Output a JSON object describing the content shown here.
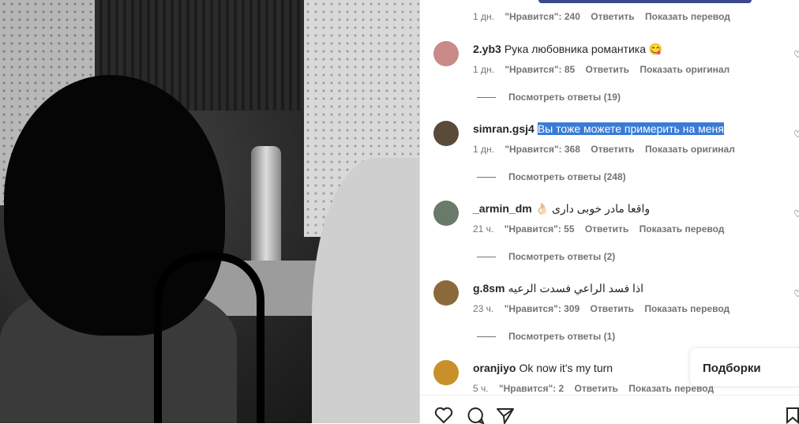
{
  "top_meta": {
    "time": "1 дн.",
    "likes": "\"Нравится\": 240",
    "reply": "Ответить",
    "translate": "Показать перевод"
  },
  "comments": [
    {
      "user": "2.yb3",
      "text": "Рука любовника романтика 😋",
      "time": "1 дн.",
      "likes": "\"Нравится\": 85",
      "reply": "Ответить",
      "action": "Показать оригинал",
      "replies": "Посмотреть ответы (19)",
      "avatar_color": "#c98a8a"
    },
    {
      "user": "simran.gsj4",
      "text": "Вы тоже можете примерить на меня",
      "time": "1 дн.",
      "likes": "\"Нравится\": 368",
      "reply": "Ответить",
      "action": "Показать оригинал",
      "replies": "Посмотреть ответы (248)",
      "avatar_color": "#5a4a3a"
    },
    {
      "user": "_armin_dm",
      "text": "👌🏻 واقعا مادر خوبی داری",
      "time": "21 ч.",
      "likes": "\"Нравится\": 55",
      "reply": "Ответить",
      "action": "Показать перевод",
      "replies": "Посмотреть ответы (2)",
      "avatar_color": "#6a7a6a"
    },
    {
      "user": "g.8sm",
      "text": "اذا فسد الراعي فسدت الرعيه",
      "time": "23 ч.",
      "likes": "\"Нравится\": 309",
      "reply": "Ответить",
      "action": "Показать перевод",
      "replies": "Посмотреть ответы (1)",
      "avatar_color": "#8a6a3a"
    },
    {
      "user": "oranjiyo",
      "text": "Ok now it's my turn",
      "time": "5 ч.",
      "likes": "\"Нравится\": 2",
      "reply": "Ответить",
      "action": "Показать перевод",
      "replies": "",
      "avatar_color": "#c8902a"
    }
  ],
  "collections_label": "Подборки",
  "icons": {
    "like": "heart-icon",
    "comment": "comment-icon",
    "share": "send-icon",
    "save": "bookmark-icon"
  },
  "colors": {
    "highlight": "#3a7bd5",
    "meta": "#737373",
    "text": "#262626"
  }
}
